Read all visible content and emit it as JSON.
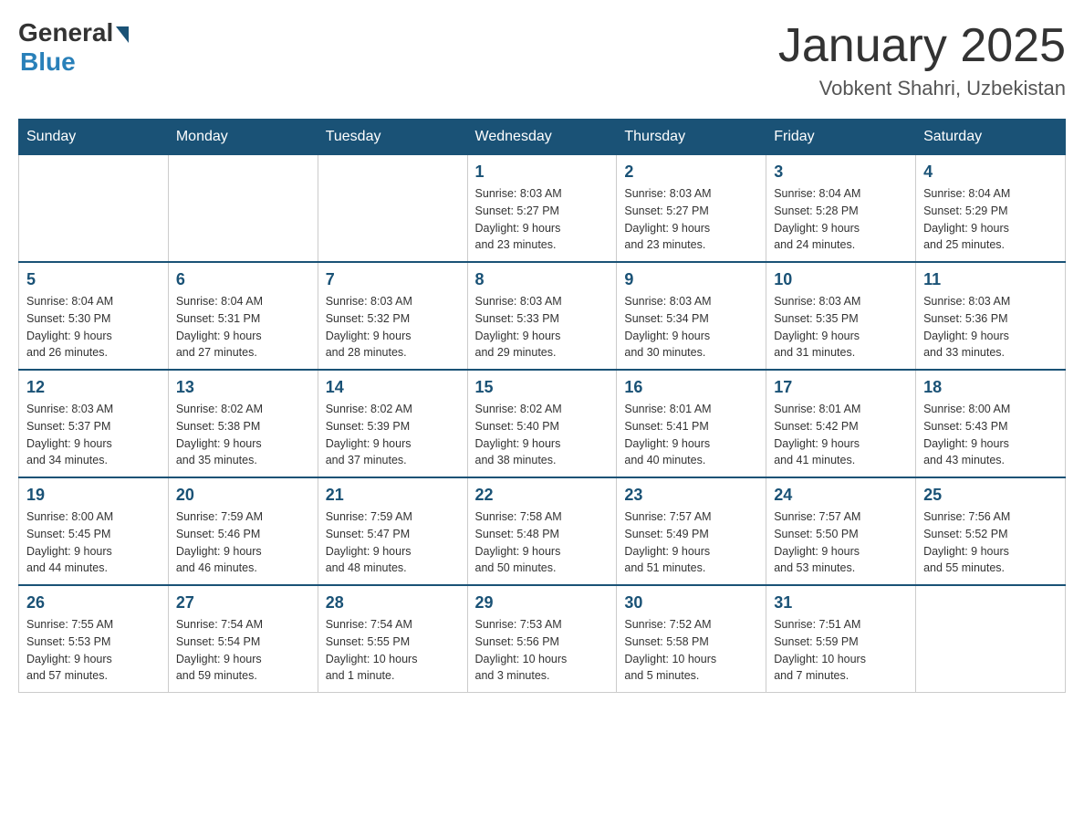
{
  "header": {
    "logo_general": "General",
    "logo_blue": "Blue",
    "month_title": "January 2025",
    "location": "Vobkent Shahri, Uzbekistan"
  },
  "weekdays": [
    "Sunday",
    "Monday",
    "Tuesday",
    "Wednesday",
    "Thursday",
    "Friday",
    "Saturday"
  ],
  "weeks": [
    [
      {
        "day": "",
        "info": ""
      },
      {
        "day": "",
        "info": ""
      },
      {
        "day": "",
        "info": ""
      },
      {
        "day": "1",
        "info": "Sunrise: 8:03 AM\nSunset: 5:27 PM\nDaylight: 9 hours\nand 23 minutes."
      },
      {
        "day": "2",
        "info": "Sunrise: 8:03 AM\nSunset: 5:27 PM\nDaylight: 9 hours\nand 23 minutes."
      },
      {
        "day": "3",
        "info": "Sunrise: 8:04 AM\nSunset: 5:28 PM\nDaylight: 9 hours\nand 24 minutes."
      },
      {
        "day": "4",
        "info": "Sunrise: 8:04 AM\nSunset: 5:29 PM\nDaylight: 9 hours\nand 25 minutes."
      }
    ],
    [
      {
        "day": "5",
        "info": "Sunrise: 8:04 AM\nSunset: 5:30 PM\nDaylight: 9 hours\nand 26 minutes."
      },
      {
        "day": "6",
        "info": "Sunrise: 8:04 AM\nSunset: 5:31 PM\nDaylight: 9 hours\nand 27 minutes."
      },
      {
        "day": "7",
        "info": "Sunrise: 8:03 AM\nSunset: 5:32 PM\nDaylight: 9 hours\nand 28 minutes."
      },
      {
        "day": "8",
        "info": "Sunrise: 8:03 AM\nSunset: 5:33 PM\nDaylight: 9 hours\nand 29 minutes."
      },
      {
        "day": "9",
        "info": "Sunrise: 8:03 AM\nSunset: 5:34 PM\nDaylight: 9 hours\nand 30 minutes."
      },
      {
        "day": "10",
        "info": "Sunrise: 8:03 AM\nSunset: 5:35 PM\nDaylight: 9 hours\nand 31 minutes."
      },
      {
        "day": "11",
        "info": "Sunrise: 8:03 AM\nSunset: 5:36 PM\nDaylight: 9 hours\nand 33 minutes."
      }
    ],
    [
      {
        "day": "12",
        "info": "Sunrise: 8:03 AM\nSunset: 5:37 PM\nDaylight: 9 hours\nand 34 minutes."
      },
      {
        "day": "13",
        "info": "Sunrise: 8:02 AM\nSunset: 5:38 PM\nDaylight: 9 hours\nand 35 minutes."
      },
      {
        "day": "14",
        "info": "Sunrise: 8:02 AM\nSunset: 5:39 PM\nDaylight: 9 hours\nand 37 minutes."
      },
      {
        "day": "15",
        "info": "Sunrise: 8:02 AM\nSunset: 5:40 PM\nDaylight: 9 hours\nand 38 minutes."
      },
      {
        "day": "16",
        "info": "Sunrise: 8:01 AM\nSunset: 5:41 PM\nDaylight: 9 hours\nand 40 minutes."
      },
      {
        "day": "17",
        "info": "Sunrise: 8:01 AM\nSunset: 5:42 PM\nDaylight: 9 hours\nand 41 minutes."
      },
      {
        "day": "18",
        "info": "Sunrise: 8:00 AM\nSunset: 5:43 PM\nDaylight: 9 hours\nand 43 minutes."
      }
    ],
    [
      {
        "day": "19",
        "info": "Sunrise: 8:00 AM\nSunset: 5:45 PM\nDaylight: 9 hours\nand 44 minutes."
      },
      {
        "day": "20",
        "info": "Sunrise: 7:59 AM\nSunset: 5:46 PM\nDaylight: 9 hours\nand 46 minutes."
      },
      {
        "day": "21",
        "info": "Sunrise: 7:59 AM\nSunset: 5:47 PM\nDaylight: 9 hours\nand 48 minutes."
      },
      {
        "day": "22",
        "info": "Sunrise: 7:58 AM\nSunset: 5:48 PM\nDaylight: 9 hours\nand 50 minutes."
      },
      {
        "day": "23",
        "info": "Sunrise: 7:57 AM\nSunset: 5:49 PM\nDaylight: 9 hours\nand 51 minutes."
      },
      {
        "day": "24",
        "info": "Sunrise: 7:57 AM\nSunset: 5:50 PM\nDaylight: 9 hours\nand 53 minutes."
      },
      {
        "day": "25",
        "info": "Sunrise: 7:56 AM\nSunset: 5:52 PM\nDaylight: 9 hours\nand 55 minutes."
      }
    ],
    [
      {
        "day": "26",
        "info": "Sunrise: 7:55 AM\nSunset: 5:53 PM\nDaylight: 9 hours\nand 57 minutes."
      },
      {
        "day": "27",
        "info": "Sunrise: 7:54 AM\nSunset: 5:54 PM\nDaylight: 9 hours\nand 59 minutes."
      },
      {
        "day": "28",
        "info": "Sunrise: 7:54 AM\nSunset: 5:55 PM\nDaylight: 10 hours\nand 1 minute."
      },
      {
        "day": "29",
        "info": "Sunrise: 7:53 AM\nSunset: 5:56 PM\nDaylight: 10 hours\nand 3 minutes."
      },
      {
        "day": "30",
        "info": "Sunrise: 7:52 AM\nSunset: 5:58 PM\nDaylight: 10 hours\nand 5 minutes."
      },
      {
        "day": "31",
        "info": "Sunrise: 7:51 AM\nSunset: 5:59 PM\nDaylight: 10 hours\nand 7 minutes."
      },
      {
        "day": "",
        "info": ""
      }
    ]
  ]
}
